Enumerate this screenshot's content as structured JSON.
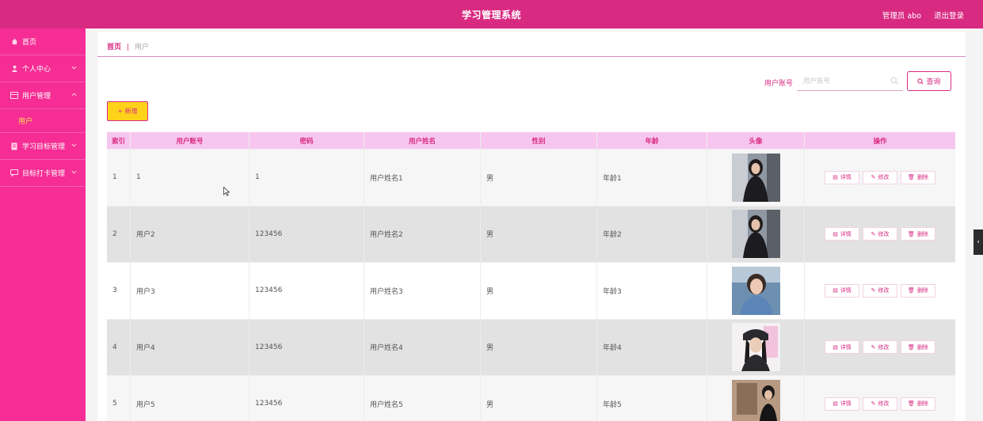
{
  "header": {
    "title": "学习管理系统",
    "user": "管理员 abo",
    "logout": "退出登录"
  },
  "sidebar": {
    "items": [
      {
        "label": "首页",
        "icon": "home-icon"
      },
      {
        "label": "个人中心",
        "icon": "user-icon",
        "chevron": "chevron-down-icon"
      },
      {
        "label": "用户管理",
        "icon": "table-icon",
        "chevron": "chevron-up-icon",
        "sub": "用户"
      },
      {
        "label": "学习目标管理",
        "icon": "doc-icon",
        "chevron": "chevron-down-icon"
      },
      {
        "label": "目标打卡管理",
        "icon": "chat-icon",
        "chevron": "chevron-down-icon"
      }
    ]
  },
  "breadcrumb": {
    "home": "首页",
    "sep": "|",
    "current": "用户"
  },
  "search": {
    "label": "用户账号",
    "placeholder": "用户账号",
    "button": "查询"
  },
  "toolbar": {
    "add": "+ 新增"
  },
  "table": {
    "headers": [
      "索引",
      "用户账号",
      "密码",
      "用户姓名",
      "性别",
      "年龄",
      "头像",
      "操作"
    ],
    "rows": [
      {
        "idx": "1",
        "account": "1",
        "password": "1",
        "name": "用户姓名1",
        "sex": "男",
        "age": "年龄1"
      },
      {
        "idx": "2",
        "account": "用户2",
        "password": "123456",
        "name": "用户姓名2",
        "sex": "男",
        "age": "年龄2"
      },
      {
        "idx": "3",
        "account": "用户3",
        "password": "123456",
        "name": "用户姓名3",
        "sex": "男",
        "age": "年龄3"
      },
      {
        "idx": "4",
        "account": "用户4",
        "password": "123456",
        "name": "用户姓名4",
        "sex": "男",
        "age": "年龄4"
      },
      {
        "idx": "5",
        "account": "用户5",
        "password": "123456",
        "name": "用户姓名5",
        "sex": "男",
        "age": "年龄5"
      }
    ],
    "actions": {
      "detail": "详情",
      "edit": "修改",
      "delete": "删除"
    }
  },
  "colors": {
    "header": "#d92a82",
    "sidebar": "#f52d94",
    "accent": "#d92a82",
    "add_button": "#ffd21a",
    "table_header": "#f7c6f0"
  }
}
